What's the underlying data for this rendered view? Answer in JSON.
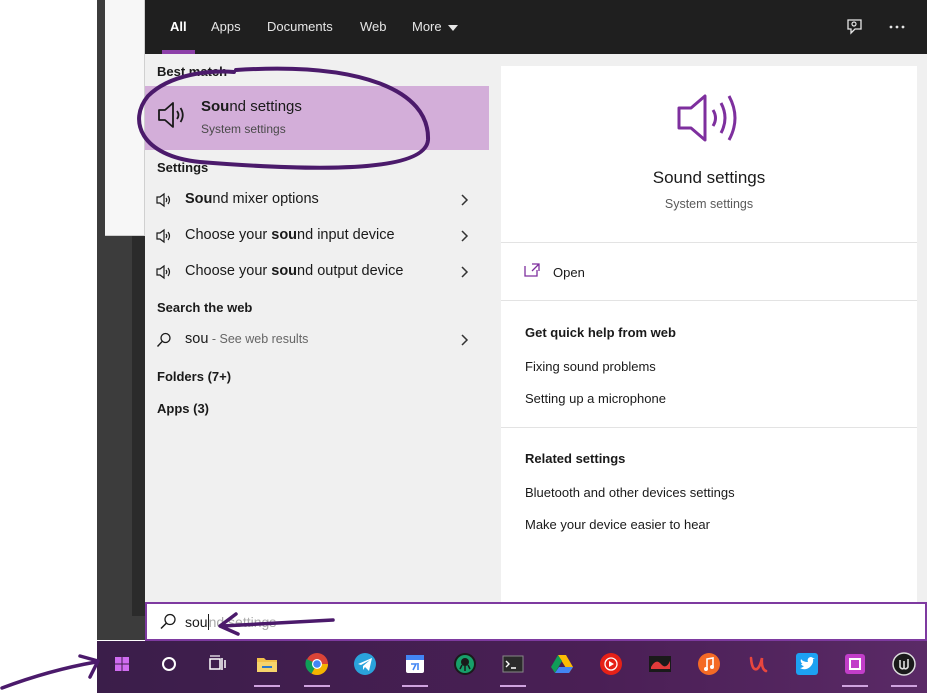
{
  "tabs": [
    {
      "label": "All"
    },
    {
      "label": "Apps"
    },
    {
      "label": "Documents"
    },
    {
      "label": "Web"
    },
    {
      "label": "More"
    }
  ],
  "left": {
    "best_match_title": "Best match",
    "best_match": {
      "name_bold": "Sou",
      "name_rest": "nd settings",
      "sub": "System settings",
      "icon": "speaker-icon"
    },
    "settings_title": "Settings",
    "settings_items": [
      {
        "pre": "",
        "bold": "Sou",
        "post": "nd mixer options"
      },
      {
        "pre": "Choose your ",
        "bold": "sou",
        "post": "nd input device"
      },
      {
        "pre": "Choose your ",
        "bold": "sou",
        "post": "nd output device"
      }
    ],
    "web_title": "Search the web",
    "web_item": {
      "query": "sou",
      "hint": " - See web results"
    },
    "folders": "Folders (7+)",
    "apps": "Apps (3)"
  },
  "preview": {
    "title": "Sound settings",
    "sub": "System settings",
    "open": "Open",
    "help_title": "Get quick help from web",
    "help_links": [
      "Fixing sound problems",
      "Setting up a microphone"
    ],
    "related_title": "Related settings",
    "related_links": [
      "Bluetooth and other devices settings",
      "Make your device easier to hear"
    ]
  },
  "search": {
    "typed": "sou",
    "ghost": "nd settings"
  },
  "colors": {
    "accent": "#8c3fa8",
    "highlight": "#d3aed9",
    "annotation": "#4b1a6b"
  },
  "taskbar_icons": [
    "windows-start-icon",
    "cortana-icon",
    "task-view-icon",
    "file-explorer-icon",
    "chrome-icon",
    "telegram-icon",
    "calendar-icon",
    "gitkraken-icon",
    "terminal-icon",
    "google-drive-icon",
    "youtube-music-icon",
    "red-app-icon",
    "music-icon",
    "u-app-icon",
    "twitter-icon",
    "pink-app-icon",
    "unreal-engine-icon"
  ]
}
